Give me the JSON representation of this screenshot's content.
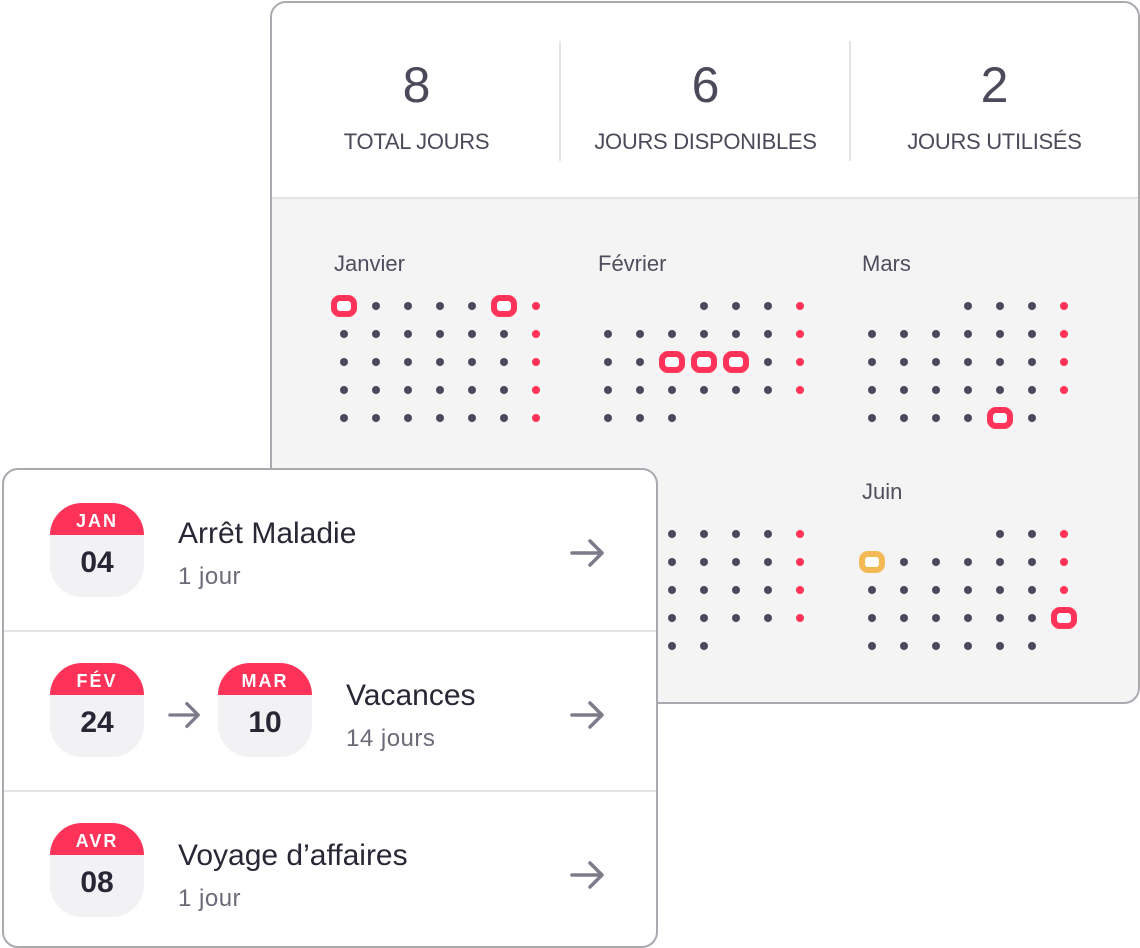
{
  "stats": [
    {
      "value": "8",
      "label": "TOTAL JOURS"
    },
    {
      "value": "6",
      "label": "JOURS DISPONIBLES"
    },
    {
      "value": "2",
      "label": "JOURS UTILISÉS"
    }
  ],
  "colors": {
    "accent": "#ff3359",
    "highlight_alt": "#f2b955",
    "dot": "#4a4a5c",
    "text_dark": "#272736",
    "text_muted": "#6a6a78",
    "panel_bg": "#f4f4f5"
  },
  "calendar": {
    "months": [
      {
        "name": "Janvier",
        "first_col": 0,
        "days": 35,
        "marked": [
          1,
          6
        ],
        "marked_yellow": []
      },
      {
        "name": "Février",
        "first_col": 3,
        "days": 28,
        "marked": [
          14,
          15,
          16
        ],
        "marked_yellow": []
      },
      {
        "name": "Mars",
        "first_col": 3,
        "days": 31,
        "marked": [
          30
        ],
        "marked_yellow": []
      },
      {
        "name": "",
        "first_col": 2,
        "days": 30,
        "marked": [
          14
        ],
        "marked_yellow": []
      },
      {
        "name": "",
        "first_col": 2,
        "days": 30,
        "marked": [],
        "marked_yellow": []
      },
      {
        "name": "Juin",
        "first_col": 4,
        "days": 30,
        "marked": [
          24
        ],
        "marked_yellow": [
          4
        ]
      }
    ]
  },
  "absences": [
    {
      "start": {
        "month": "JAN",
        "day": "04"
      },
      "end": null,
      "title": "Arrêt Maladie",
      "duration": "1 jour",
      "icon": "arrow-right-icon"
    },
    {
      "start": {
        "month": "FÉV",
        "day": "24"
      },
      "end": {
        "month": "MAR",
        "day": "10"
      },
      "title": "Vacances",
      "duration": "14 jours",
      "icon": "arrow-right-icon"
    },
    {
      "start": {
        "month": "AVR",
        "day": "08"
      },
      "end": null,
      "title": "Voyage d’affaires",
      "duration": "1 jour",
      "icon": "arrow-right-icon"
    }
  ]
}
